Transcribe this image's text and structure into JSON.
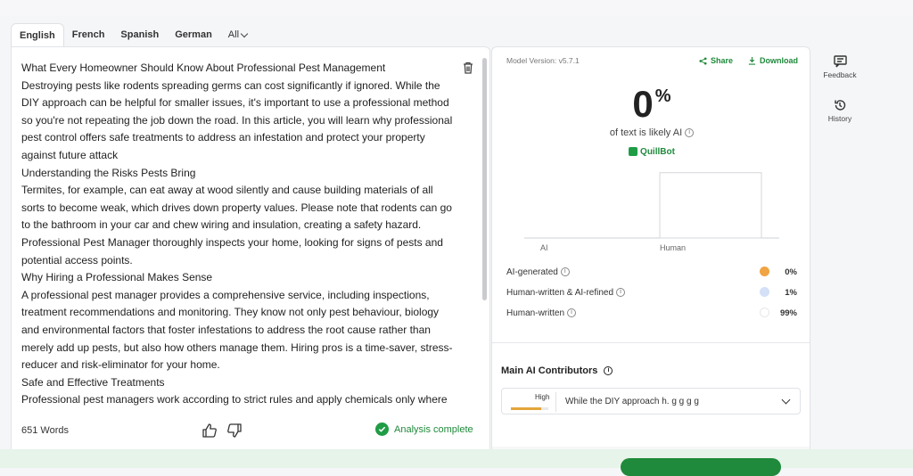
{
  "tabs": [
    {
      "label": "English",
      "active": true
    },
    {
      "label": "French",
      "active": false
    },
    {
      "label": "Spanish",
      "active": false
    },
    {
      "label": "German",
      "active": false
    },
    {
      "label": "All",
      "active": false
    }
  ],
  "editor": {
    "paragraphs": [
      "What Every Homeowner Should Know About Professional Pest Management",
      "Destroying pests like  rodents spreading germs can cost significantly if ignored. While the DIY approach can be helpful for smaller issues, it's important  to use a professional method so you're not repeating the job down the road. In this article, you will learn why professional pest  control offers safe treatments to address an infestation and protect your property against future attack",
      "Understanding the Risks Pests Bring",
      "Termites,  for example, can eat away at wood silently and cause building materials of all sorts to become weak, which drives down property values. Please note that rodents can go to the bathroom in your car  and chew wiring and insulation, creating a safety hazard. Professional Pest Manager thoroughly inspects your home, looking for signs of pests and potential access points.",
      "Why Hiring a Professional Makes Sense",
      "A professional pest manager provides a comprehensive service, including  inspections, treatment recommendations and monitoring. They know not only pest behaviour, biology and environmental factors that foster infestations to address the root cause rather than merely add up pests, but also how others manage them. Hiring pros  is a time-saver, stress-reducer and risk-eliminator for your home.",
      "Safe and Effective Treatments",
      "Professional pest managers work according to strict rules and apply  chemicals only where"
    ],
    "word_count": "651 Words",
    "status": "Analysis complete"
  },
  "results": {
    "model_version": "Model Version: v5.7.1",
    "share_label": "Share",
    "download_label": "Download",
    "score": "0",
    "score_unit": "%",
    "likely_text": "of text is likely AI",
    "brand": "QuillBot",
    "stats": [
      {
        "label": "AI-generated",
        "value": "0%",
        "color": "#f0a443"
      },
      {
        "label": "Human-written & AI-refined",
        "value": "1%",
        "color": "#d3e0f7"
      },
      {
        "label": "Human-written",
        "value": "99%",
        "color": "#ffffff"
      }
    ],
    "contributors_title": "Main AI Contributors",
    "contributor": {
      "level": "High",
      "level_fraction": 0.8,
      "text": "While the DIY approach h. g g g g"
    }
  },
  "chart_data": {
    "type": "bar",
    "categories": [
      "AI",
      "Human"
    ],
    "values": [
      0,
      99
    ],
    "title": "",
    "xlabel": "",
    "ylabel": "",
    "ylim": [
      0,
      100
    ],
    "grid": false
  },
  "side": {
    "feedback_label": "Feedback",
    "history_label": "History"
  }
}
